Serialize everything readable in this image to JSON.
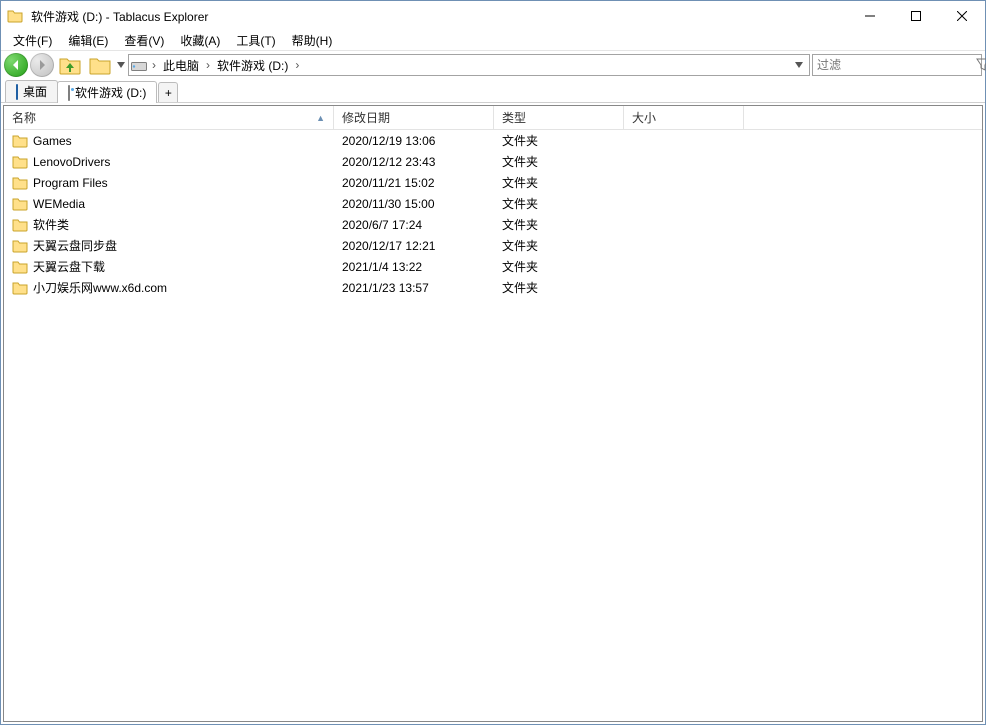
{
  "title": "软件游戏 (D:) - Tablacus Explorer",
  "menus": [
    "文件(F)",
    "编辑(E)",
    "查看(V)",
    "收藏(A)",
    "工具(T)",
    "帮助(H)"
  ],
  "breadcrumb": {
    "root": "此电脑",
    "segments": [
      "软件游戏 (D:)"
    ]
  },
  "filter_placeholder": "过滤",
  "tabs": [
    {
      "label": "桌面",
      "icon": "desktop"
    },
    {
      "label": "软件游戏 (D:)",
      "icon": "drive"
    }
  ],
  "tab_add": "+",
  "columns": {
    "name": "名称",
    "date": "修改日期",
    "type": "类型",
    "size": "大小"
  },
  "rows": [
    {
      "name": "Games",
      "date": "2020/12/19 13:06",
      "type": "文件夹",
      "size": ""
    },
    {
      "name": "LenovoDrivers",
      "date": "2020/12/12 23:43",
      "type": "文件夹",
      "size": ""
    },
    {
      "name": "Program Files",
      "date": "2020/11/21 15:02",
      "type": "文件夹",
      "size": ""
    },
    {
      "name": "WEMedia",
      "date": "2020/11/30 15:00",
      "type": "文件夹",
      "size": ""
    },
    {
      "name": "软件类",
      "date": "2020/6/7 17:24",
      "type": "文件夹",
      "size": ""
    },
    {
      "name": "天翼云盘同步盘",
      "date": "2020/12/17 12:21",
      "type": "文件夹",
      "size": ""
    },
    {
      "name": "天翼云盘下载",
      "date": "2021/1/4 13:22",
      "type": "文件夹",
      "size": ""
    },
    {
      "name": "小刀娱乐网www.x6d.com",
      "date": "2021/1/23 13:57",
      "type": "文件夹",
      "size": ""
    }
  ]
}
